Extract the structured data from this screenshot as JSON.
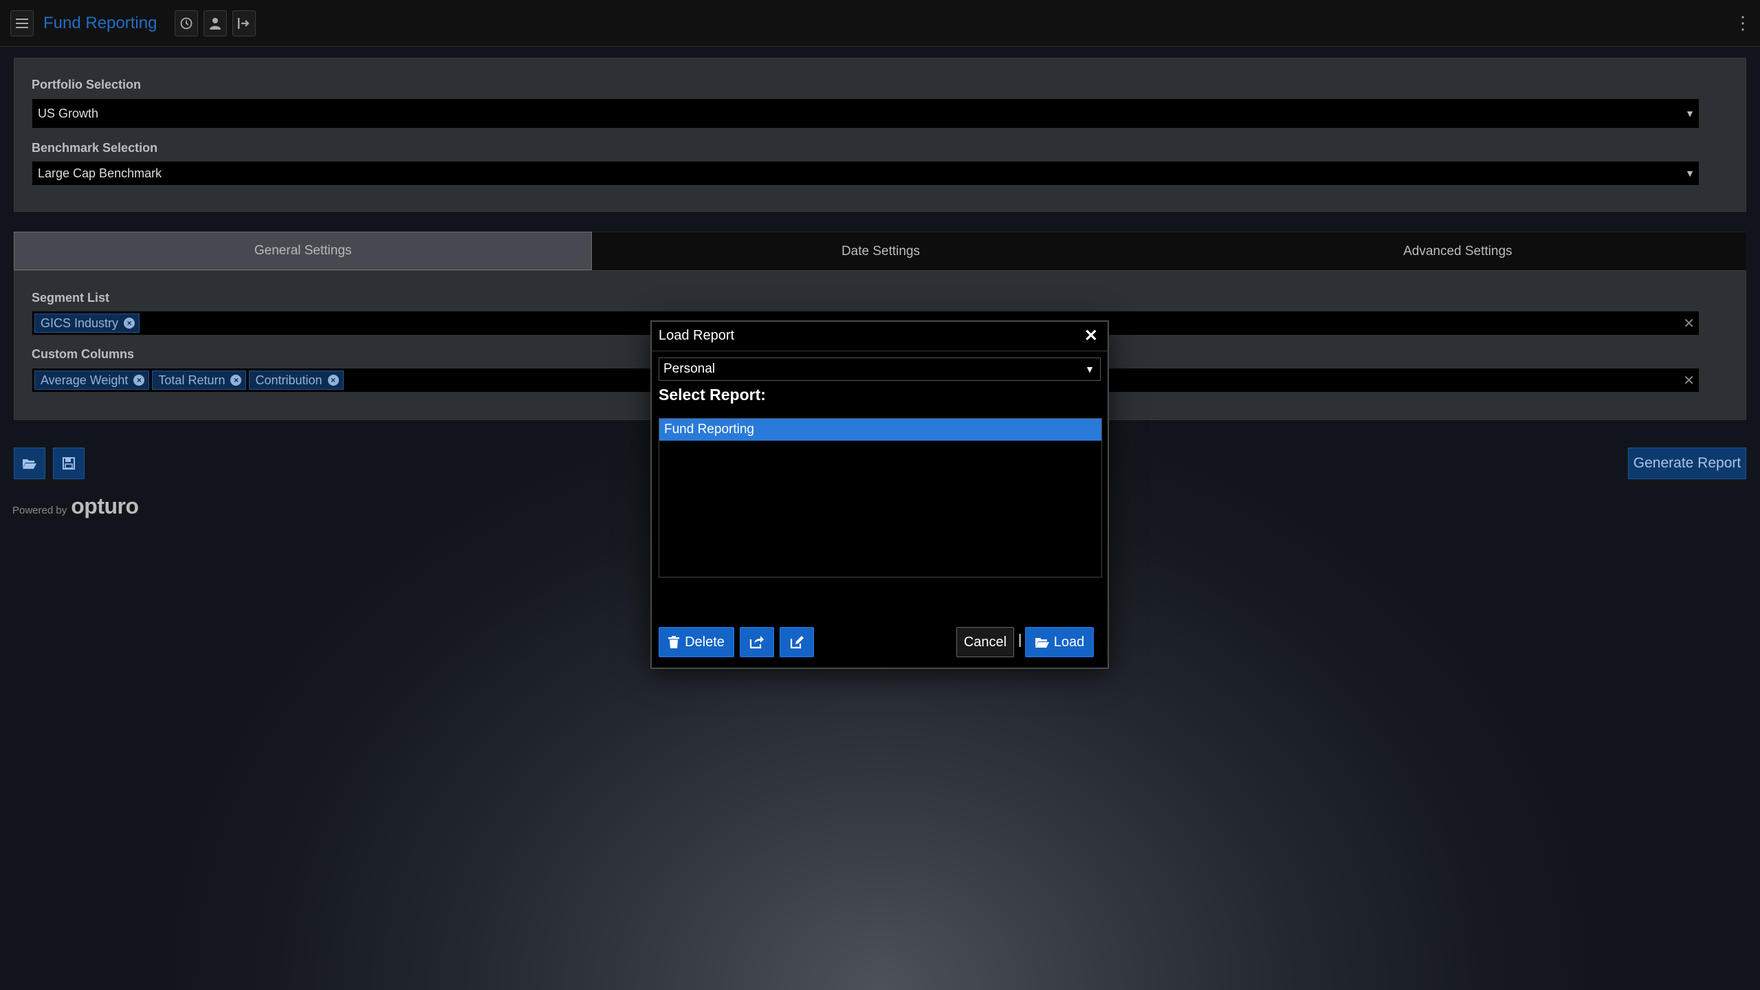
{
  "header": {
    "app_title": "Fund Reporting",
    "icons": [
      "menu-icon",
      "history-icon",
      "user-icon",
      "logout-icon",
      "more-vertical-icon"
    ]
  },
  "portfolio": {
    "label": "Portfolio Selection",
    "value": "US Growth"
  },
  "benchmark": {
    "label": "Benchmark Selection",
    "value": "Large Cap Benchmark"
  },
  "tabs": [
    {
      "label": "General Settings",
      "active": true
    },
    {
      "label": "Date Settings",
      "active": false
    },
    {
      "label": "Advanced Settings",
      "active": false
    }
  ],
  "segment_list": {
    "label": "Segment List",
    "tags": [
      "GICS Industry"
    ]
  },
  "custom_columns": {
    "label": "Custom Columns",
    "tags": [
      "Average Weight",
      "Total Return",
      "Contribution"
    ]
  },
  "actions": {
    "generate_label": "Generate Report"
  },
  "footer": {
    "powered_by": "Powered by",
    "brand": "opturo"
  },
  "modal": {
    "title": "Load Report",
    "scope_value": "Personal",
    "select_label": "Select Report:",
    "reports": [
      "Fund Reporting"
    ],
    "selected_report": "Fund Reporting",
    "delete_label": "Delete",
    "cancel_label": "Cancel",
    "separator": "|",
    "load_label": "Load"
  },
  "colors": {
    "accent": "#1464c8",
    "title_blue": "#1f6fc2",
    "selection": "#2a7ad9",
    "chip_bg": "#0e2c52"
  }
}
